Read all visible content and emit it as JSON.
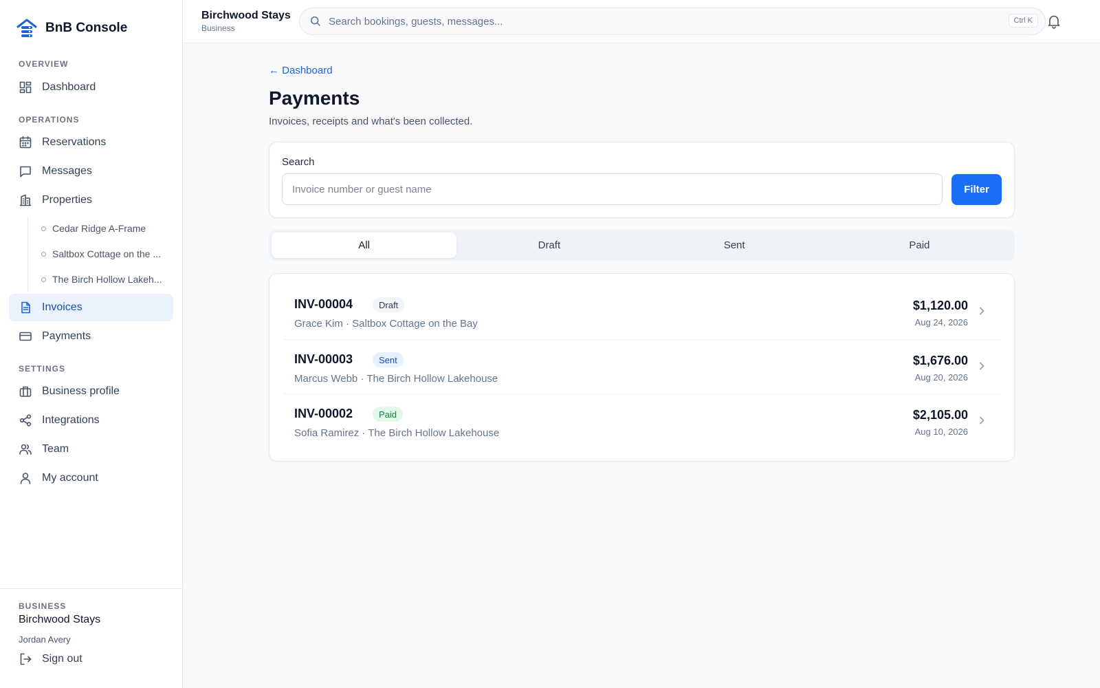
{
  "brand": {
    "name": "BnB Console"
  },
  "sidebar": {
    "sections": {
      "overview": "OVERVIEW",
      "operations": "OPERATIONS",
      "settings": "SETTINGS"
    },
    "items": {
      "dashboard": "Dashboard",
      "reservations": "Reservations",
      "messages": "Messages",
      "properties": "Properties",
      "invoices": "Invoices",
      "payments": "Payments",
      "business_profile": "Business profile",
      "integrations": "Integrations",
      "team": "Team",
      "my_account": "My account"
    },
    "properties": [
      "Cedar Ridge A-Frame",
      "Saltbox Cottage on the ...",
      "The Birch Hollow Lakeh..."
    ],
    "active_item": "invoices",
    "footer": {
      "label": "BUSINESS",
      "business": "Birchwood Stays",
      "user": "Jordan Avery",
      "sign_out": "Sign out"
    }
  },
  "topbar": {
    "workspace": "Birchwood Stays",
    "workspace_type": "Business",
    "search_placeholder": "Search bookings, guests, messages...",
    "shortcut": "Ctrl K"
  },
  "main": {
    "back_link": "← Dashboard",
    "title": "Payments",
    "subtitle": "Invoices, receipts and what's been collected.",
    "search": {
      "label": "Search",
      "placeholder": "Invoice number or guest name",
      "button": "Filter"
    },
    "tabs": [
      {
        "label": "All",
        "active": true
      },
      {
        "label": "Draft",
        "active": false
      },
      {
        "label": "Sent",
        "active": false
      },
      {
        "label": "Paid",
        "active": false
      }
    ],
    "invoices": [
      {
        "number": "INV-00004",
        "status": "Draft",
        "details": "Grace Kim · Saltbox Cottage on the Bay",
        "amount": "$1,120.00",
        "date": "Aug 24, 2026"
      },
      {
        "number": "INV-00003",
        "status": "Sent",
        "details": "Marcus Webb · The Birch Hollow Lakehouse",
        "amount": "$1,676.00",
        "date": "Aug 20, 2026"
      },
      {
        "number": "INV-00002",
        "status": "Paid",
        "details": "Sofia Ramirez · The Birch Hollow Lakehouse",
        "amount": "$2,105.00",
        "date": "Aug 10, 2026"
      }
    ]
  },
  "colors": {
    "accent": "#1a6ef5",
    "active_nav_bg": "#eaf2fe",
    "badge_sent_bg": "#e6f0fe",
    "badge_paid_bg": "#e3f8ea"
  }
}
